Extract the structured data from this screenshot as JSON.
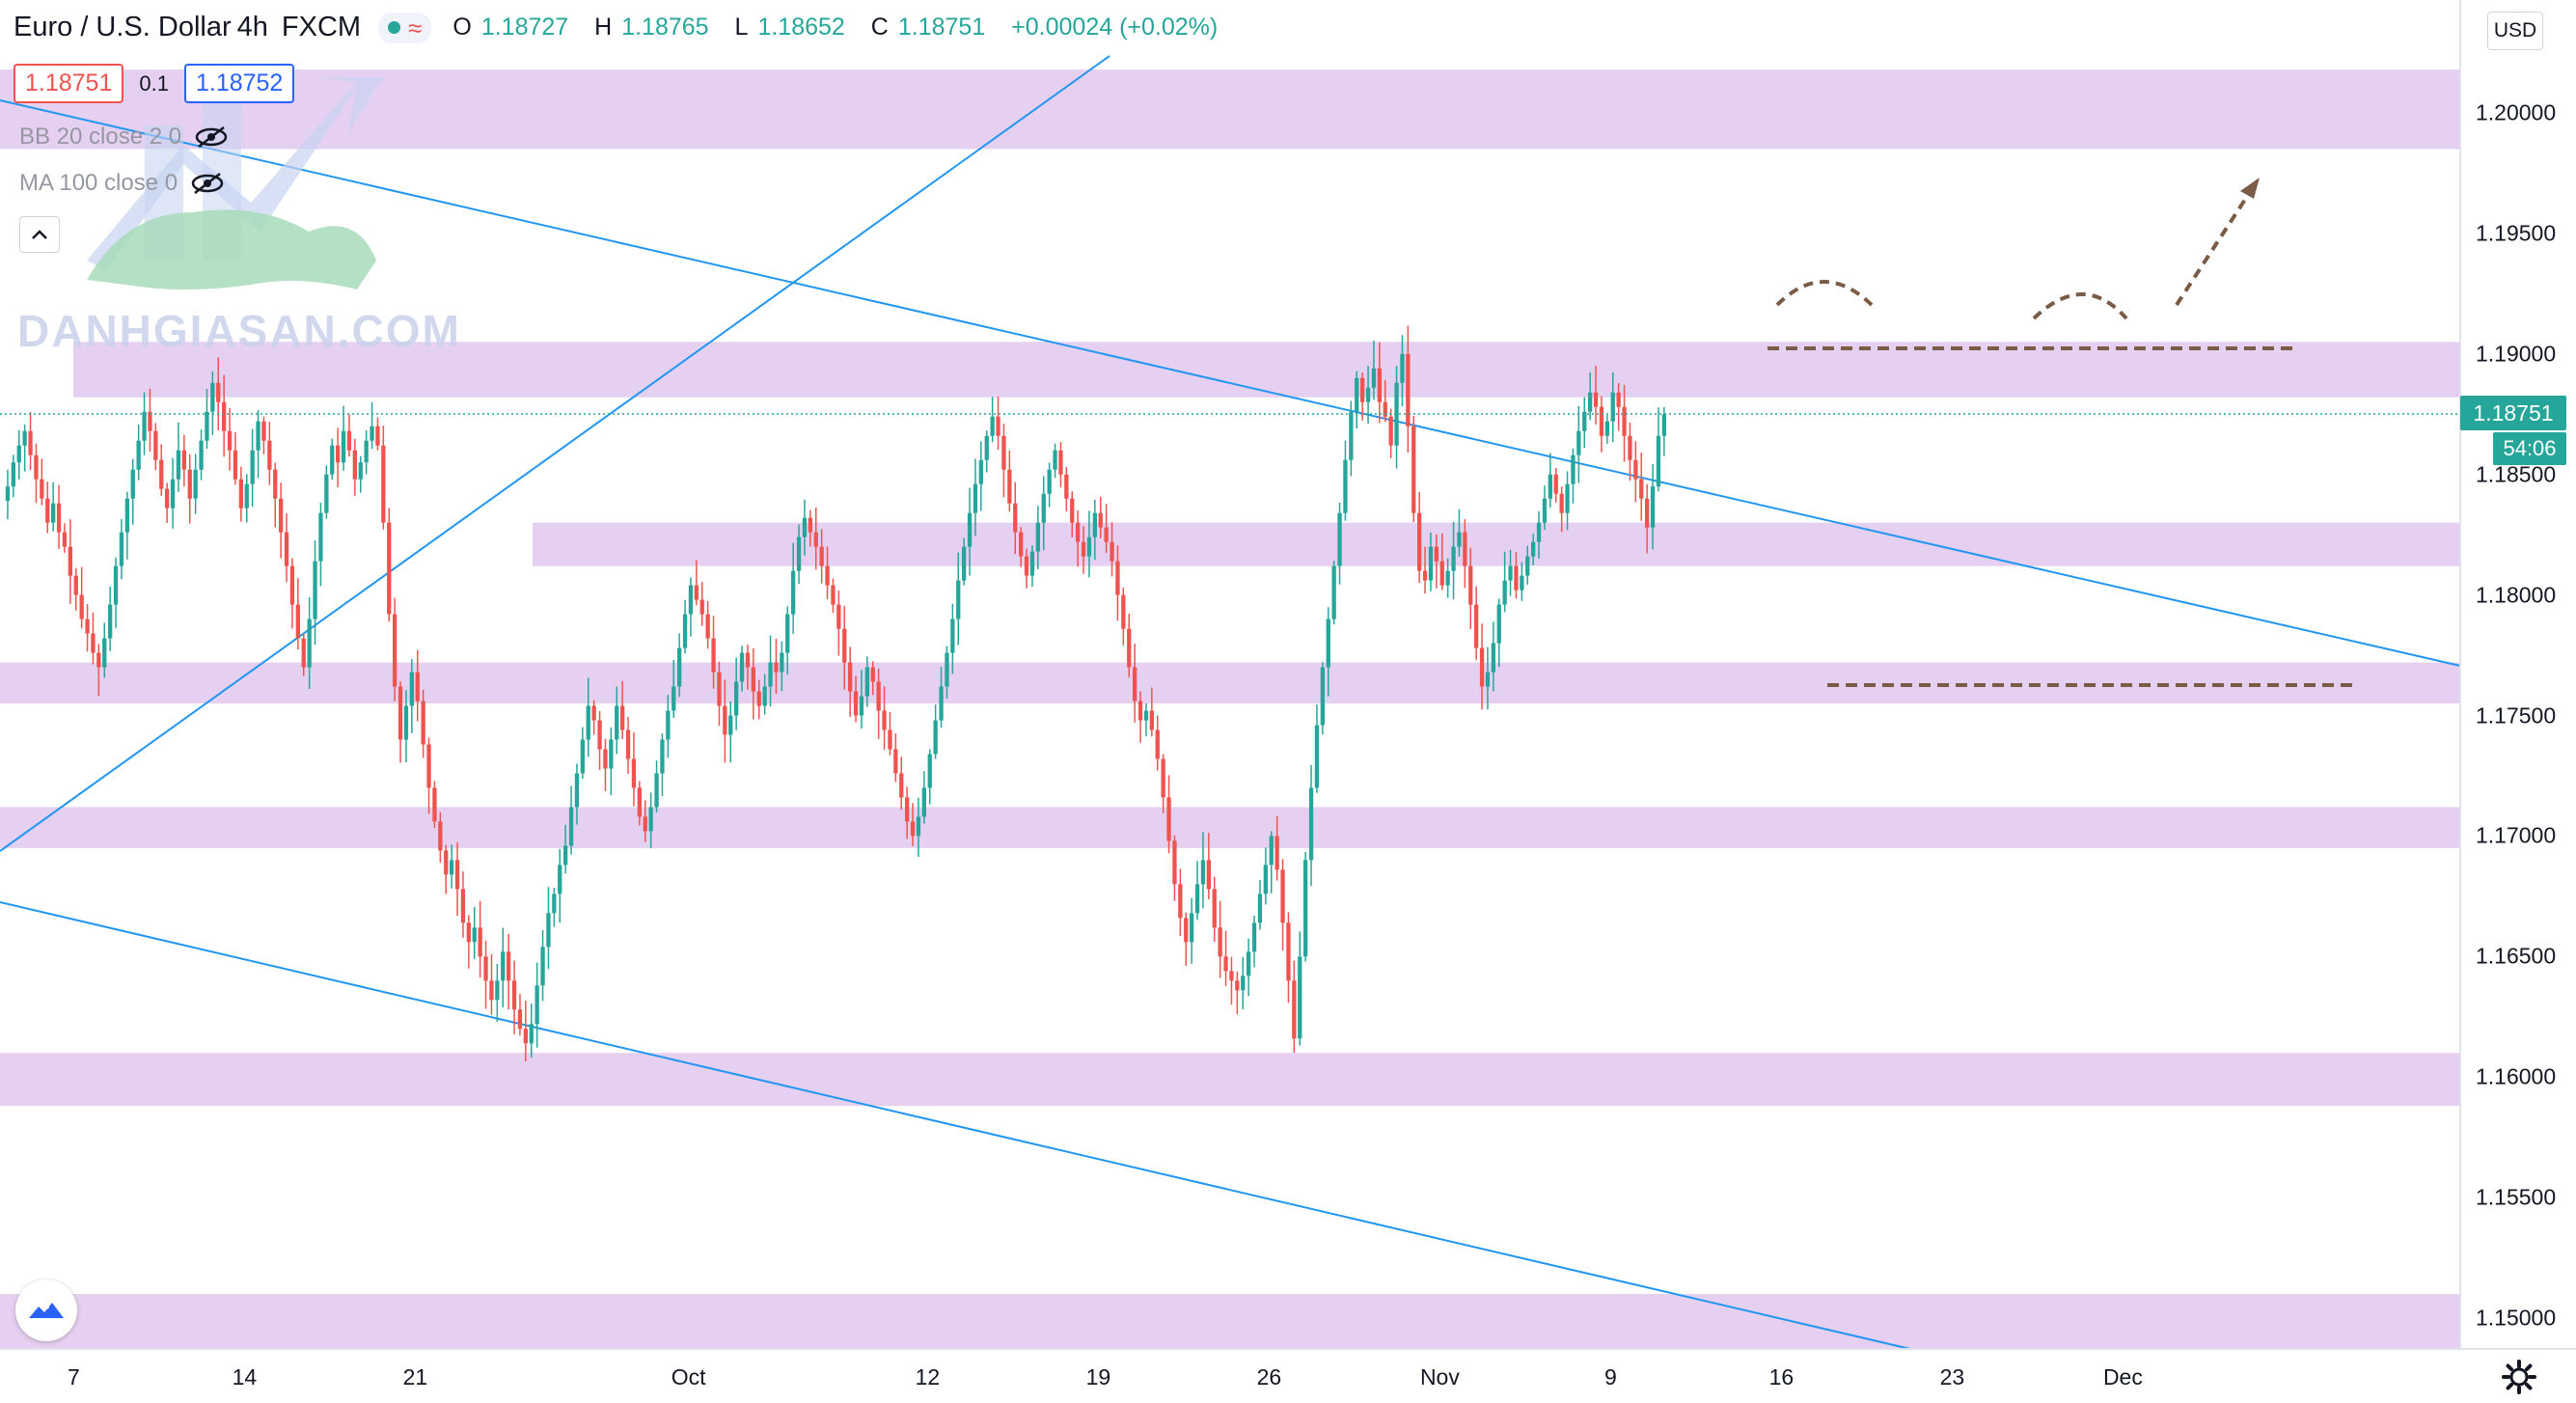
{
  "header": {
    "symbol": "Euro / U.S. Dollar",
    "interval": "4h",
    "exchange": "FXCM",
    "open_label": "O",
    "open": "1.18727",
    "high_label": "H",
    "high": "1.18765",
    "low_label": "L",
    "low": "1.18652",
    "close_label": "C",
    "close": "1.18751",
    "change": "+0.00024 (+0.02%)"
  },
  "quote": {
    "bid": "1.18751",
    "spread": "0.1",
    "ask": "1.18752"
  },
  "indicators": [
    {
      "label": "BB 20 close 2 0"
    },
    {
      "label": "MA 100 close 0"
    }
  ],
  "watermark": "DANHGIASAN.COM",
  "currency_button": "USD",
  "last_price_label": "1.18751",
  "countdown": "54:06",
  "colors": {
    "up": "#26a69a",
    "down": "#ef5350",
    "zone": "#e2c8ee",
    "trendline": "#2196f3",
    "annotation": "#7a5c46"
  },
  "chart_data": {
    "type": "candlestick",
    "title": "",
    "xlabel": "",
    "ylabel": "",
    "ylim": [
      1.1475,
      1.2055
    ],
    "grid": false,
    "y_ticks": [
      "1.20000",
      "1.19500",
      "1.19000",
      "1.18500",
      "1.18000",
      "1.17500",
      "1.17000",
      "1.16500",
      "1.16000",
      "1.15500",
      "1.15000"
    ],
    "x_ticks": [
      {
        "label": "7",
        "bar": 6
      },
      {
        "label": "14",
        "bar": 36
      },
      {
        "label": "21",
        "bar": 66
      },
      {
        "label": "Oct",
        "bar": 114
      },
      {
        "label": "12",
        "bar": 156
      },
      {
        "label": "19",
        "bar": 186
      },
      {
        "label": "26",
        "bar": 216
      },
      {
        "label": "Nov",
        "bar": 246
      },
      {
        "label": "9",
        "bar": 276
      },
      {
        "label": "16",
        "bar": 306
      },
      {
        "label": "23",
        "bar": 336
      },
      {
        "label": "Dec",
        "bar": 366
      }
    ],
    "bar_count_visible": 380,
    "closes": [
      1.1845,
      1.1855,
      1.1862,
      1.1868,
      1.1858,
      1.1848,
      1.184,
      1.183,
      1.1838,
      1.1826,
      1.182,
      1.1808,
      1.18,
      1.179,
      1.1784,
      1.1776,
      1.177,
      1.1782,
      1.1796,
      1.1812,
      1.1826,
      1.184,
      1.1852,
      1.1864,
      1.1876,
      1.1868,
      1.1856,
      1.1844,
      1.1836,
      1.1848,
      1.186,
      1.1852,
      1.184,
      1.1852,
      1.1864,
      1.1876,
      1.1888,
      1.188,
      1.1868,
      1.186,
      1.1848,
      1.1836,
      1.1846,
      1.186,
      1.1872,
      1.1864,
      1.1852,
      1.184,
      1.1826,
      1.1812,
      1.1796,
      1.1782,
      1.177,
      1.179,
      1.1814,
      1.1834,
      1.185,
      1.1862,
      1.1855,
      1.1868,
      1.186,
      1.1848,
      1.1855,
      1.1864,
      1.187,
      1.1862,
      1.183,
      1.1792,
      1.1762,
      1.174,
      1.1754,
      1.1768,
      1.1756,
      1.1738,
      1.172,
      1.1706,
      1.1694,
      1.1684,
      1.169,
      1.1678,
      1.1664,
      1.1656,
      1.1662,
      1.165,
      1.164,
      1.1632,
      1.164,
      1.1652,
      1.164,
      1.1628,
      1.162,
      1.1614,
      1.1622,
      1.1638,
      1.1654,
      1.1668,
      1.1676,
      1.1688,
      1.1696,
      1.1712,
      1.1726,
      1.174,
      1.1754,
      1.1748,
      1.1736,
      1.1728,
      1.174,
      1.1754,
      1.1744,
      1.1732,
      1.172,
      1.1708,
      1.1702,
      1.1712,
      1.1726,
      1.174,
      1.1752,
      1.1762,
      1.1778,
      1.1792,
      1.1804,
      1.1798,
      1.1792,
      1.1782,
      1.1768,
      1.1754,
      1.1742,
      1.175,
      1.1764,
      1.1776,
      1.177,
      1.176,
      1.1754,
      1.1762,
      1.1772,
      1.1768,
      1.1776,
      1.1792,
      1.181,
      1.1824,
      1.1832,
      1.1826,
      1.182,
      1.1812,
      1.1804,
      1.1796,
      1.1786,
      1.1772,
      1.176,
      1.175,
      1.1758,
      1.177,
      1.1764,
      1.1752,
      1.1744,
      1.1736,
      1.1726,
      1.1716,
      1.1706,
      1.17,
      1.1708,
      1.172,
      1.1734,
      1.1748,
      1.1762,
      1.1776,
      1.179,
      1.1806,
      1.182,
      1.1834,
      1.1846,
      1.1856,
      1.1866,
      1.1874,
      1.1866,
      1.1852,
      1.1838,
      1.1826,
      1.1816,
      1.1808,
      1.1818,
      1.183,
      1.1842,
      1.1852,
      1.186,
      1.185,
      1.184,
      1.183,
      1.1822,
      1.1816,
      1.1824,
      1.1834,
      1.1828,
      1.1822,
      1.1814,
      1.18,
      1.1786,
      1.177,
      1.1756,
      1.1748,
      1.1752,
      1.1744,
      1.1732,
      1.1716,
      1.1698,
      1.168,
      1.1666,
      1.1656,
      1.1668,
      1.168,
      1.169,
      1.1678,
      1.1662,
      1.165,
      1.1644,
      1.164,
      1.1636,
      1.1642,
      1.1652,
      1.1664,
      1.1676,
      1.1688,
      1.17,
      1.1686,
      1.1664,
      1.164,
      1.1616,
      1.165,
      1.169,
      1.172,
      1.1746,
      1.177,
      1.179,
      1.1812,
      1.1834,
      1.1856,
      1.1876,
      1.189,
      1.188,
      1.1886,
      1.1894,
      1.188,
      1.1874,
      1.1862,
      1.1888,
      1.19,
      1.187,
      1.1834,
      1.181,
      1.1806,
      1.182,
      1.1814,
      1.1804,
      1.181,
      1.182,
      1.1826,
      1.1812,
      1.1796,
      1.1778,
      1.1762,
      1.1768,
      1.178,
      1.1796,
      1.1806,
      1.1812,
      1.1802,
      1.1808,
      1.1816,
      1.1822,
      1.183,
      1.184,
      1.185,
      1.1842,
      1.1834,
      1.1846,
      1.1858,
      1.1868,
      1.1876,
      1.1884,
      1.1878,
      1.1866,
      1.1872,
      1.1884,
      1.1878,
      1.1866,
      1.1856,
      1.1848,
      1.184,
      1.1828,
      1.1845,
      1.1866,
      1.1875
    ],
    "annotations": {
      "resistance_level": 1.1902,
      "support_level": 1.1762,
      "zones": [
        [
          1.1985,
          1.2018
        ],
        [
          1.1882,
          1.1905
        ],
        [
          1.1812,
          1.183
        ],
        [
          1.1755,
          1.1772
        ],
        [
          1.1695,
          1.1712
        ],
        [
          1.1588,
          1.161
        ],
        [
          1.1485,
          1.151
        ]
      ]
    }
  }
}
